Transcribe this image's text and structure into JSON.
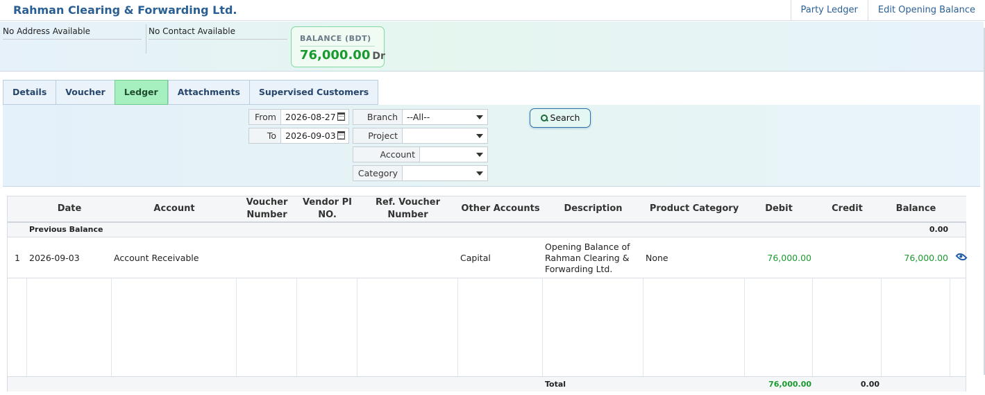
{
  "header": {
    "company_name": "Rahman Clearing & Forwarding Ltd.",
    "links": [
      "Party Ledger",
      "Edit Opening Balance"
    ]
  },
  "info": {
    "address": "No Address Available",
    "contact": "No Contact Available",
    "balance_label": "BALANCE (BDT)",
    "balance_value": "76,000.00",
    "balance_type": "Dr"
  },
  "tabs": [
    {
      "label": "Details",
      "active": false
    },
    {
      "label": "Voucher",
      "active": false
    },
    {
      "label": "Ledger",
      "active": true
    },
    {
      "label": "Attachments",
      "active": false
    },
    {
      "label": "Supervised Customers",
      "active": false
    }
  ],
  "filters": {
    "from_label": "From",
    "from_value": "2026-08-27",
    "to_label": "To",
    "to_value": "2026-09-03",
    "branch_label": "Branch",
    "branch_value": "--All--",
    "project_label": "Project",
    "project_value": "",
    "account_label": "Account",
    "account_value": "",
    "category_label": "Category",
    "category_value": "",
    "search_label": "Search"
  },
  "table": {
    "columns": [
      "",
      "Date",
      "Account",
      "Voucher Number",
      "Vendor PI NO.",
      "Ref. Voucher Number",
      "Other Accounts",
      "Description",
      "Product Category",
      "Debit",
      "Credit",
      "Balance",
      ""
    ],
    "previous_balance_label": "Previous Balance",
    "previous_balance_value": "0.00",
    "rows": [
      {
        "index": "1",
        "date": "2026-09-03",
        "account": "Account Receivable",
        "voucher_number": "",
        "vendor_pi": "",
        "ref_voucher": "",
        "other_accounts": "Capital",
        "description": "Opening Balance of Rahman Clearing & Forwarding Ltd.",
        "product_category": "None",
        "debit": "76,000.00",
        "credit": "",
        "balance": "76,000.00"
      }
    ],
    "total_label": "Total",
    "total_debit": "76,000.00",
    "total_credit": "0.00"
  },
  "colors": {
    "brand": "#2a5f94",
    "positive": "#1a9a2e",
    "active_tab": "#a6f0bf"
  }
}
